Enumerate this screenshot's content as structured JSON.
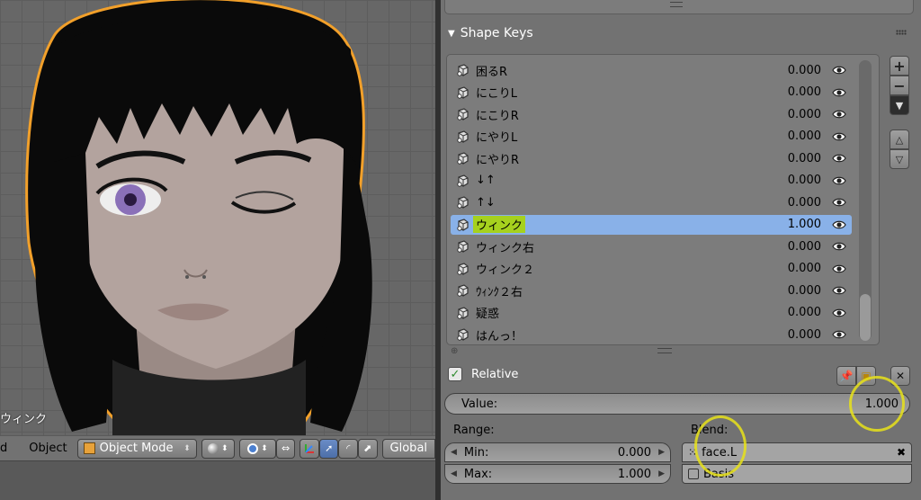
{
  "viewport": {
    "object_label": "ウィンク",
    "header": {
      "menu_view": "d",
      "menu_object": "Object",
      "mode": "Object Mode",
      "orientation": "Global"
    }
  },
  "shape_keys": {
    "title": "Shape Keys",
    "items": [
      {
        "name": "困るR",
        "value": "0.000",
        "selected": false
      },
      {
        "name": "にこりL",
        "value": "0.000",
        "selected": false
      },
      {
        "name": "にこりR",
        "value": "0.000",
        "selected": false
      },
      {
        "name": "にやりL",
        "value": "0.000",
        "selected": false
      },
      {
        "name": "にやりR",
        "value": "0.000",
        "selected": false
      },
      {
        "name": "↓↑",
        "value": "0.000",
        "selected": false
      },
      {
        "name": "↑↓",
        "value": "0.000",
        "selected": false
      },
      {
        "name": "ウィンク",
        "value": "1.000",
        "selected": true
      },
      {
        "name": "ウィンク右",
        "value": "0.000",
        "selected": false
      },
      {
        "name": "ウィンク２",
        "value": "0.000",
        "selected": false
      },
      {
        "name": "ｳｨﾝｸ２右",
        "value": "0.000",
        "selected": false
      },
      {
        "name": "疑惑",
        "value": "0.000",
        "selected": false
      },
      {
        "name": "はんっ！",
        "value": "0.000",
        "selected": false
      }
    ],
    "relative_label": "Relative",
    "relative_checked": true,
    "value_label": "Value:",
    "value": "1.000",
    "range_label": "Range:",
    "min_label": "Min:",
    "min_value": "0.000",
    "max_label": "Max:",
    "max_value": "1.000",
    "blend_label": "Blend:",
    "vertex_group": "face.L",
    "relative_key": "Basis"
  },
  "colors": {
    "selected_row": "#89b1e8",
    "highlight_marker": "#a6d11e",
    "annotation_circle": "#e8e21a",
    "outline_selected": "#f2a02a"
  }
}
